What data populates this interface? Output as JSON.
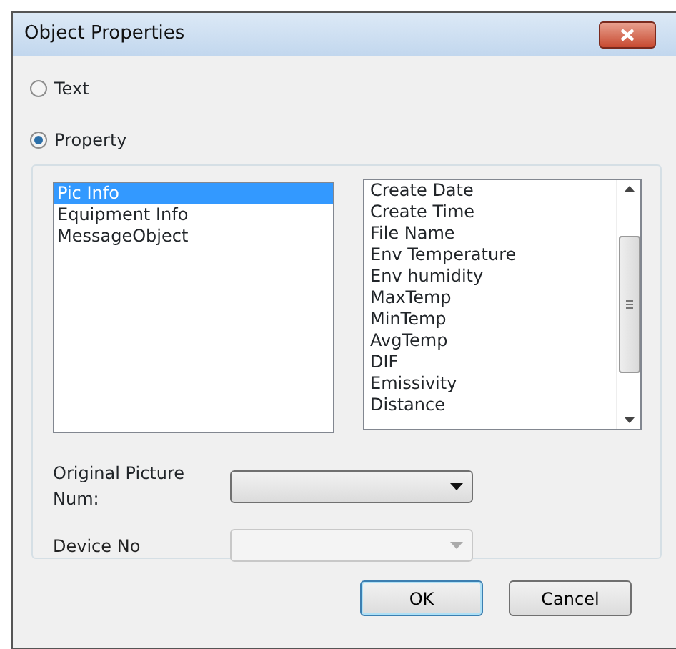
{
  "window": {
    "title": "Object Properties"
  },
  "modes": [
    {
      "label": "Text",
      "selected": false
    },
    {
      "label": "Property",
      "selected": true
    }
  ],
  "categories": [
    {
      "label": "Pic Info",
      "selected": true
    },
    {
      "label": "Equipment Info",
      "selected": false
    },
    {
      "label": "MessageObject",
      "selected": false
    }
  ],
  "properties": [
    "Create Date",
    "Create Time",
    "File Name",
    "Env Temperature",
    "Env humidity",
    "MaxTemp",
    "MinTemp",
    "AvgTemp",
    "DIF",
    "Emissivity",
    "Distance"
  ],
  "fields": [
    {
      "label": "Original Picture Num:",
      "disabled": false
    },
    {
      "label": "Device No",
      "disabled": true
    }
  ],
  "buttons": [
    {
      "label": "OK",
      "default": true
    },
    {
      "label": "Cancel",
      "default": false
    }
  ]
}
